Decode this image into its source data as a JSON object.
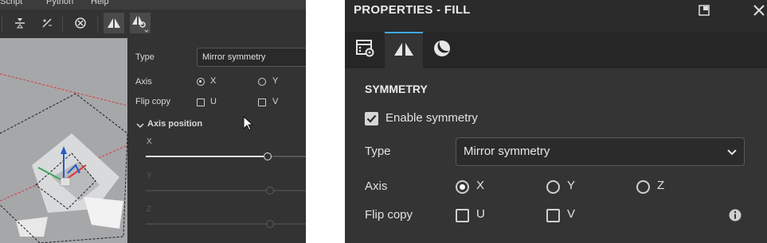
{
  "menubar": {
    "items": [
      "aScript",
      "Python",
      "Help"
    ]
  },
  "toolbar": {
    "icons": [
      "align-center-icon",
      "axis-swap-icon",
      "no-entry-icon",
      "symmetry-icon",
      "symmetry-settings-icon"
    ]
  },
  "left_panel": {
    "type_label": "Type",
    "type_value": "Mirror symmetry",
    "axis_label": "Axis",
    "axis_options": [
      "X",
      "Y"
    ],
    "axis_selected": "X",
    "flip_label": "Flip copy",
    "flip_options": [
      "U",
      "V"
    ],
    "axis_position_label": "Axis position",
    "slider_labels": [
      "X",
      "Y",
      "Z"
    ],
    "slider_x_fraction": 0.76
  },
  "right_panel": {
    "title": "PROPERTIES - FILL",
    "tabs": [
      {
        "icon": "layer-settings-icon"
      },
      {
        "icon": "symmetry-icon",
        "active": true
      },
      {
        "icon": "material-sphere-icon"
      }
    ],
    "section_title": "SYMMETRY",
    "enable_label": "Enable symmetry",
    "enable_checked": true,
    "type_label": "Type",
    "type_value": "Mirror symmetry",
    "axis_label": "Axis",
    "axis_options": [
      "X",
      "Y",
      "Z"
    ],
    "axis_selected": "X",
    "flip_label": "Flip copy",
    "flip_options": [
      "U",
      "V"
    ]
  },
  "colors": {
    "accent": "#3fa9e7",
    "panel_bg": "#343434",
    "guide_red": "#d83a3a"
  }
}
